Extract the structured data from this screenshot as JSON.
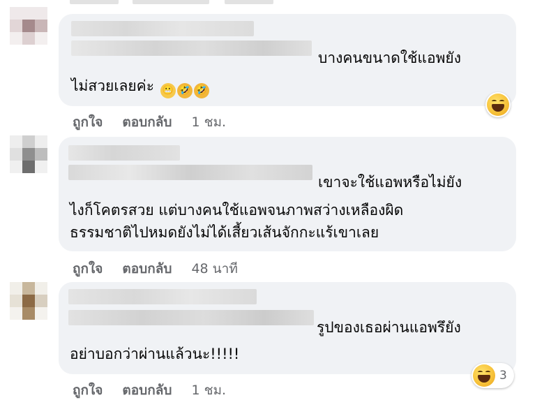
{
  "comments": [
    {
      "text_line1": "บางคนขนาดใช้แอพยัง",
      "text_line2": "ไม่สวยเลยค่ะ",
      "like": "ถูกใจ",
      "reply": "ตอบกลับ",
      "time": "1 ชม."
    },
    {
      "text_line1": "เขาจะใช้แอพหรือไม่ยัง",
      "text_line2": "ไงก็โคตรสวย แต่บางคนใช้แอพจนภาพสว่างเหลืองผิด",
      "text_line3": "ธรรมชาติไปหมดยังไม่ได้เสี้ยวเส้นจักกะแร้เขาเลย",
      "like": "ถูกใจ",
      "reply": "ตอบกลับ",
      "time": "48 นาที"
    },
    {
      "text_line1": "รูปของเธอผ่านแอพรึยัง",
      "text_line2": "อย่าบอกว่าผ่านแล้วนะ!!!!!",
      "like": "ถูกใจ",
      "reply": "ตอบกลับ",
      "time": "1 ชม.",
      "reaction_count": "3"
    }
  ],
  "colors": {
    "bubble": "#f0f2f5",
    "action_text": "#65676b",
    "comment_text": "#050505",
    "haha_reaction": "#f7c33b"
  },
  "icons": [
    "haha-reaction-icon",
    "grimace-emoji",
    "rofl-emoji"
  ]
}
